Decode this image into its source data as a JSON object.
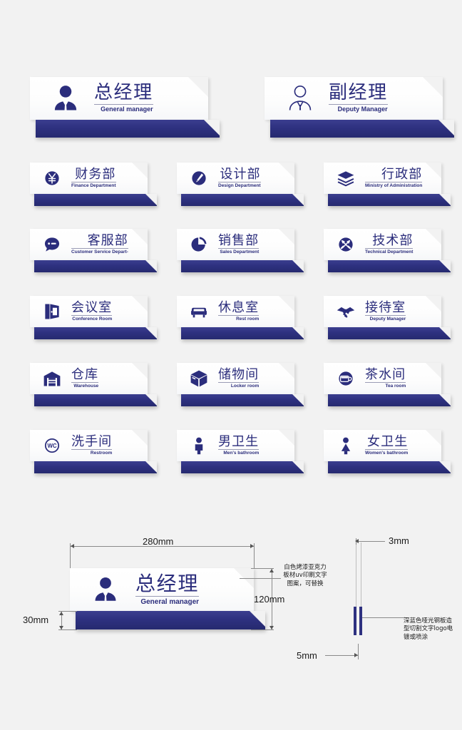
{
  "palette": {
    "deep_blue": "#2e3180",
    "text_blue": "#2b2d7c",
    "background": "#f2f2f2",
    "plate_white": "#ffffff",
    "rule_gray": "#9a9cb5"
  },
  "signs": [
    {
      "id": "general-manager",
      "cn": "总经理",
      "en": "General manager",
      "icon": "businessman-solid-icon",
      "size": "big"
    },
    {
      "id": "deputy-manager",
      "cn": "副经理",
      "en": "Deputy Manager",
      "icon": "businessman-outline-icon",
      "size": "big"
    },
    {
      "id": "finance-department",
      "cn": "财务部",
      "en": "Finance Department",
      "icon": "yuan-coin-icon",
      "size": "sm"
    },
    {
      "id": "design-department",
      "cn": "设计部",
      "en": "Design Department",
      "icon": "pen-circle-icon",
      "size": "sm"
    },
    {
      "id": "ministry-of-administration",
      "cn": "行政部",
      "en": "Ministry of Administration",
      "icon": "layers-stack-icon",
      "size": "sm"
    },
    {
      "id": "customer-service-department",
      "cn": "客服部",
      "en": "Customer Service Depart-",
      "icon": "speech-bubble-icon",
      "size": "sm"
    },
    {
      "id": "sales-department",
      "cn": "销售部",
      "en": "Sales Department",
      "icon": "pie-chart-icon",
      "size": "sm"
    },
    {
      "id": "technical-department",
      "cn": "技术部",
      "en": "Technical Department",
      "icon": "tools-circle-icon",
      "size": "sm"
    },
    {
      "id": "conference-room",
      "cn": "会议室",
      "en": "Conference Room",
      "icon": "door-icon",
      "size": "sm"
    },
    {
      "id": "rest-room",
      "cn": "休息室",
      "en": "Rest room",
      "icon": "armchair-icon",
      "size": "sm"
    },
    {
      "id": "reception-room",
      "cn": "接待室",
      "en": "Deputy Manager",
      "icon": "handshake-icon",
      "size": "sm"
    },
    {
      "id": "warehouse",
      "cn": "仓库",
      "en": "Warehouse",
      "icon": "warehouse-icon",
      "size": "sm"
    },
    {
      "id": "locker-room",
      "cn": "储物间",
      "en": "Locker room",
      "icon": "box-icon",
      "size": "sm"
    },
    {
      "id": "tea-room",
      "cn": "茶水间",
      "en": "Tea room",
      "icon": "cup-circle-icon",
      "size": "sm"
    },
    {
      "id": "restroom",
      "cn": "洗手间",
      "en": "Restroom",
      "icon": "wc-circle-icon",
      "size": "sm"
    },
    {
      "id": "mens-bathroom",
      "cn": "男卫生",
      "en": "Men's bathroom",
      "icon": "man-icon",
      "size": "sm"
    },
    {
      "id": "womens-bathroom",
      "cn": "女卫生",
      "en": "Women's bathroom",
      "icon": "woman-icon",
      "size": "sm"
    }
  ],
  "spec": {
    "sample_cn": "总经理",
    "sample_en": "General manager",
    "sample_icon": "businessman-solid-icon",
    "dimensions": {
      "width": "280mm",
      "height": "120mm",
      "base_height": "30mm",
      "plate_thickness": "3mm",
      "base_thickness": "5mm"
    },
    "notes": {
      "plate_material": "白色烤漆亚克力板材uv印刷文字图案，可替换",
      "base_material": "深蓝色哑光钢板造型切割文字logo电镀或喷涂"
    }
  }
}
